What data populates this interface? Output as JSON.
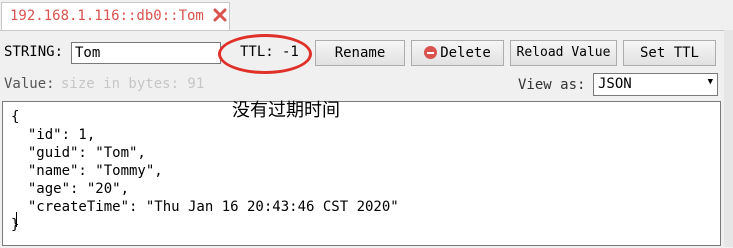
{
  "tab": {
    "title": "192.168.1.116::db0::Tom",
    "close_icon": "close-icon",
    "title_color": "#d9534f"
  },
  "toolbar": {
    "type_label": "STRING:",
    "key_value": "Tom",
    "ttl_label": "TTL:",
    "ttl_value": "-1",
    "rename_label": "Rename",
    "delete_label": "Delete",
    "delete_icon": "delete-icon",
    "reload_label": "Reload Value",
    "set_ttl_label": "Set TTL"
  },
  "value_bar": {
    "label": "Value:",
    "size_hint": "size in bytes: 91",
    "view_as_label": "View as:",
    "view_as_selected": "JSON"
  },
  "annotation": {
    "text": "没有过期时间",
    "circle_color": "#e0302a"
  },
  "editor": {
    "lines": [
      "{",
      "  \"id\": 1,",
      "  \"guid\": \"Tom\",",
      "  \"name\": \"Tommy\",",
      "  \"age\": \"20\",",
      "  \"createTime\": \"Thu Jan 16 20:43:46 CST 2020\"",
      "}"
    ]
  }
}
